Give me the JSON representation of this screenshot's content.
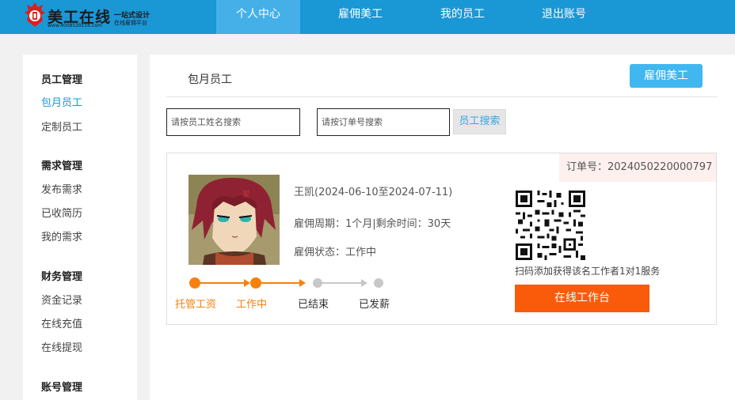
{
  "logo": {
    "title": "美工在线",
    "url": "www.4008539156.com",
    "slogan_line1": "一站式设计",
    "slogan_line2": "在线雇佣平台"
  },
  "nav": {
    "items": [
      {
        "label": "个人中心",
        "active": true
      },
      {
        "label": "雇佣美工",
        "active": false
      },
      {
        "label": "我的员工",
        "active": false
      },
      {
        "label": "退出账号",
        "active": false
      }
    ]
  },
  "sidebar": {
    "groups": [
      {
        "title": "员工管理",
        "items": [
          "包月员工",
          "定制员工"
        ]
      },
      {
        "title": "需求管理",
        "items": [
          "发布需求",
          "已收简历",
          "我的需求"
        ]
      },
      {
        "title": "财务管理",
        "items": [
          "资金记录",
          "在线充值",
          "在线提现"
        ]
      },
      {
        "title": "账号管理",
        "items": []
      }
    ],
    "active_item": "包月员工"
  },
  "main": {
    "tab_label": "包月员工",
    "hire_button": "雇佣美工",
    "search": {
      "name_placeholder": "请按员工姓名搜索",
      "order_placeholder": "请按订单号搜索",
      "button": "员工搜索"
    },
    "card": {
      "order_number": "订单号：2024050220000797",
      "employee_line": "王凯(2024-06-10至2024-07-11)",
      "period_line": "雇佣周期：1个月|剩余时间：30天",
      "status_line": "雇佣状态：工作中",
      "steps": [
        {
          "label": "托管工资",
          "done": true
        },
        {
          "label": "工作中",
          "done": true
        },
        {
          "label": "已结束",
          "done": false
        },
        {
          "label": "已发薪",
          "done": false
        }
      ],
      "qr_caption": "扫码添加获得该名工作者1对1服务",
      "workbench_button": "在线工作台"
    }
  },
  "colors": {
    "primary": "#1a97d5",
    "active_tab": "#45b0e8",
    "accent_orange": "#fa5b0b",
    "step_done": "#f7810d",
    "step_todo": "#c8c8c8"
  }
}
